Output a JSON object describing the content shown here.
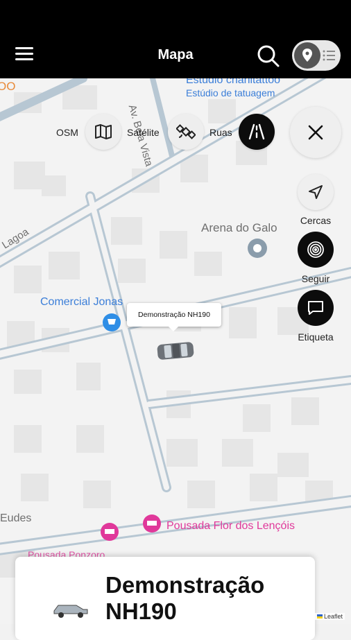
{
  "header": {
    "title": "Mapa"
  },
  "map": {
    "labels": {
      "studio_name": "Estudio charlitattoo",
      "studio_type": "Estúdio de tatuagem",
      "street_bela_vista": "Av. Bela Vista",
      "street_lagoa": "Lagoa",
      "arena": "Arena do Galo",
      "comercial": "Comercial Jonas",
      "eudes": "Eudes",
      "pousada_flor": "Pousada Flor dos Lençóis",
      "pousada_other": "Pousada Ponzoro",
      "partial_orange": "OO"
    },
    "layers": [
      {
        "label": "OSM",
        "icon": "map-icon"
      },
      {
        "label": "Satélite",
        "icon": "satellite-icon"
      },
      {
        "label": "Ruas",
        "icon": "road-icon",
        "active": true
      }
    ],
    "side_buttons": [
      {
        "label": "Cercas",
        "icon": "navigation-arrow-icon"
      },
      {
        "label": "Seguir",
        "icon": "fingerprint-icon"
      },
      {
        "label": "Etiqueta",
        "icon": "message-icon"
      }
    ],
    "vehicle_tooltip": "Demonstração NH190",
    "attribution": "Leaflet"
  },
  "card": {
    "title": "Demonstração NH190"
  },
  "colors": {
    "header": "#000000",
    "active_button": "#0c0c0c",
    "poi_blue": "#3b7ed8",
    "poi_pink": "#e0389a",
    "road": "#b7c7d3"
  }
}
